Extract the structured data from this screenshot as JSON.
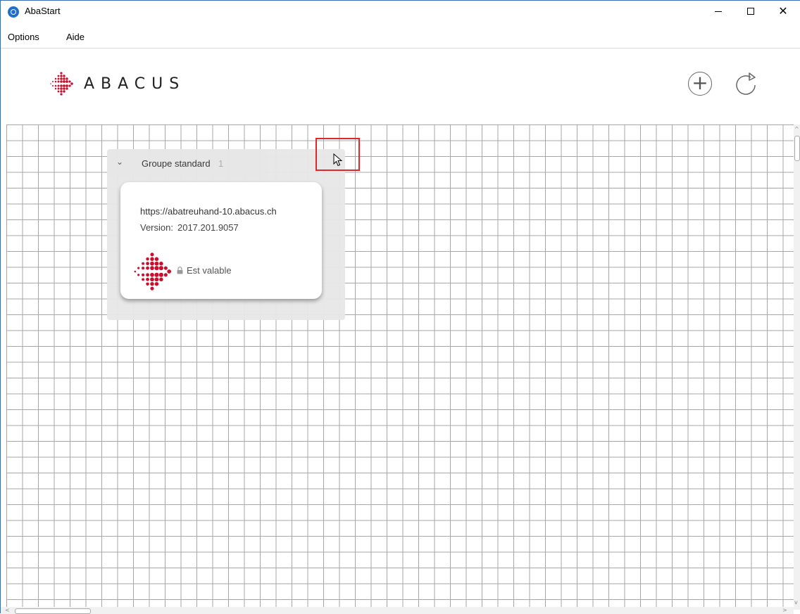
{
  "window": {
    "title": "AbaStart",
    "close_glyph": "✕"
  },
  "menu": {
    "items": [
      "Options",
      "Aide"
    ]
  },
  "header": {
    "logo_text": "ABACUS",
    "add_glyph": "+",
    "brand_color": "#c8102e"
  },
  "group": {
    "chevron": "⌄",
    "title": "Groupe standard",
    "count": "1"
  },
  "card": {
    "url": "https://abatreuhand-10.abacus.ch",
    "version_label": "Version:",
    "version_value": "2017.201.9057",
    "status": "Est valable"
  },
  "scroll": {
    "up": "^",
    "down": "v",
    "left": "<",
    "right": ">"
  },
  "highlight_color": "#e1262c"
}
